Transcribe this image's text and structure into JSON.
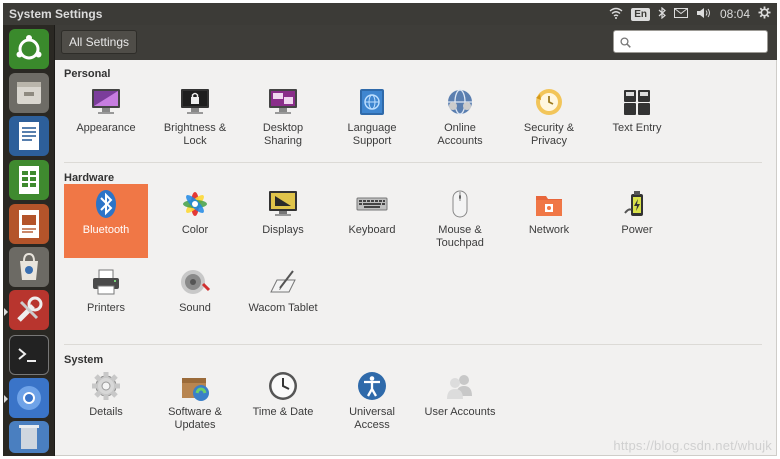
{
  "window": {
    "title": "System Settings"
  },
  "indicators": {
    "keyboard_layout": "En",
    "time": "08:04"
  },
  "toolbar": {
    "all_settings_label": "All Settings",
    "search_placeholder": "",
    "search_value": ""
  },
  "sections": {
    "personal": {
      "title": "Personal",
      "items": [
        {
          "label": "Appearance",
          "icon": "appearance-icon"
        },
        {
          "label": "Brightness &\nLock",
          "icon": "brightness-lock-icon"
        },
        {
          "label": "Desktop\nSharing",
          "icon": "desktop-sharing-icon"
        },
        {
          "label": "Language\nSupport",
          "icon": "language-icon"
        },
        {
          "label": "Online\nAccounts",
          "icon": "online-accounts-icon"
        },
        {
          "label": "Security &\nPrivacy",
          "icon": "security-privacy-icon"
        },
        {
          "label": "Text Entry",
          "icon": "keyboard-entry-icon"
        }
      ]
    },
    "hardware": {
      "title": "Hardware",
      "items": [
        {
          "label": "Bluetooth",
          "icon": "bluetooth-icon",
          "selected": true
        },
        {
          "label": "Color",
          "icon": "color-icon"
        },
        {
          "label": "Displays",
          "icon": "display-icon"
        },
        {
          "label": "Keyboard",
          "icon": "keyboard-icon"
        },
        {
          "label": "Mouse &\nTouchpad",
          "icon": "mouse-icon"
        },
        {
          "label": "Network",
          "icon": "network-icon"
        },
        {
          "label": "Power",
          "icon": "power-icon"
        },
        {
          "label": "Printers",
          "icon": "printer-icon"
        },
        {
          "label": "Sound",
          "icon": "speaker-icon"
        },
        {
          "label": "Wacom Tablet",
          "icon": "tablet-icon"
        }
      ]
    },
    "system": {
      "title": "System",
      "items": [
        {
          "label": "Details",
          "icon": "gear-icon"
        },
        {
          "label": "Software &\nUpdates",
          "icon": "software-updates-icon"
        },
        {
          "label": "Time & Date",
          "icon": "clock-icon"
        },
        {
          "label": "Universal\nAccess",
          "icon": "accessibility-icon"
        },
        {
          "label": "User Accounts",
          "icon": "user-accounts-icon"
        }
      ]
    }
  },
  "watermark": "https://blog.csdn.net/whujk",
  "colors": {
    "selection": "#f07746",
    "panel": "#3c3b37",
    "launcher": "#2a2823",
    "window_bg": "#f2f1f0"
  }
}
